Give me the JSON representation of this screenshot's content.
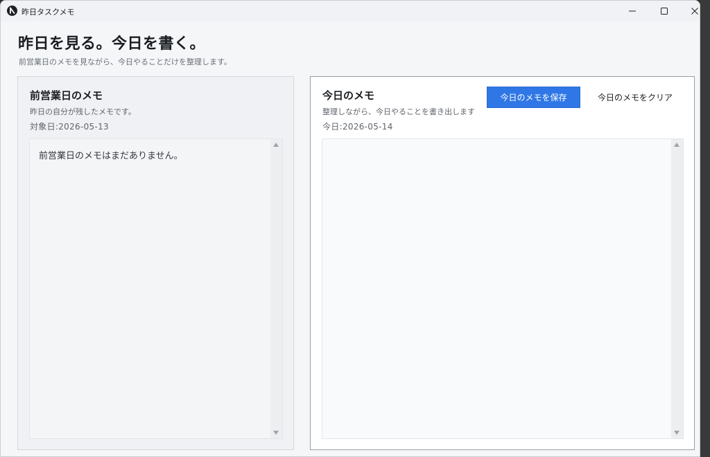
{
  "window": {
    "title": "昨日タスクメモ"
  },
  "header": {
    "title": "昨日を見る。今日を書く。",
    "subtitle": "前営業日のメモを見ながら、今日やることだけを整理します。"
  },
  "left_panel": {
    "title": "前営業日のメモ",
    "description": "昨日の自分が残したメモです。",
    "date": "対象日:2026-05-13",
    "memo_text": "前営業日のメモはまだありません。"
  },
  "right_panel": {
    "title": "今日のメモ",
    "description": "整理しながら、今日やることを書き出します",
    "date": "今日:2026-05-14",
    "memo_text": "",
    "save_label": "今日のメモを保存",
    "clear_label": "今日のメモをクリア"
  },
  "colors": {
    "accent": "#2f77e6",
    "background": "#f4f6f8"
  }
}
